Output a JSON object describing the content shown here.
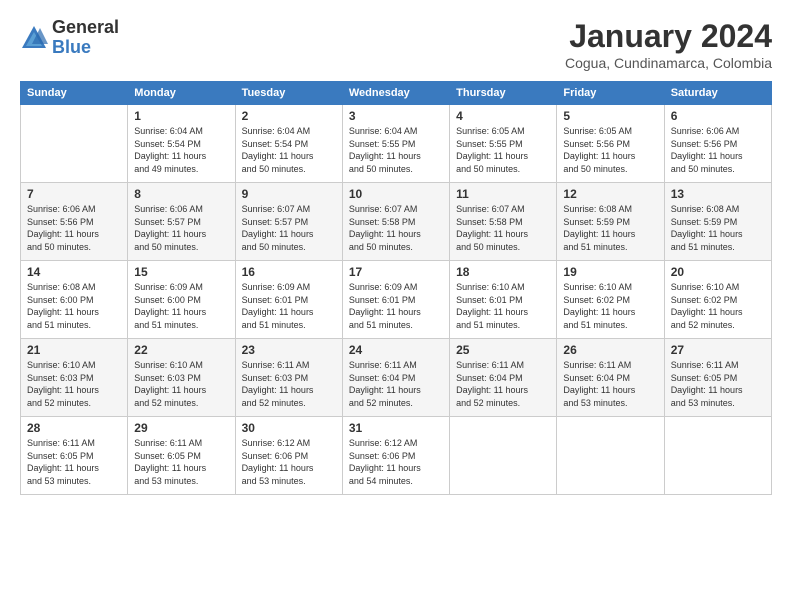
{
  "logo": {
    "general": "General",
    "blue": "Blue"
  },
  "title": "January 2024",
  "location": "Cogua, Cundinamarca, Colombia",
  "weekdays": [
    "Sunday",
    "Monday",
    "Tuesday",
    "Wednesday",
    "Thursday",
    "Friday",
    "Saturday"
  ],
  "weeks": [
    [
      {
        "day": "",
        "info": ""
      },
      {
        "day": "1",
        "info": "Sunrise: 6:04 AM\nSunset: 5:54 PM\nDaylight: 11 hours\nand 49 minutes."
      },
      {
        "day": "2",
        "info": "Sunrise: 6:04 AM\nSunset: 5:54 PM\nDaylight: 11 hours\nand 50 minutes."
      },
      {
        "day": "3",
        "info": "Sunrise: 6:04 AM\nSunset: 5:55 PM\nDaylight: 11 hours\nand 50 minutes."
      },
      {
        "day": "4",
        "info": "Sunrise: 6:05 AM\nSunset: 5:55 PM\nDaylight: 11 hours\nand 50 minutes."
      },
      {
        "day": "5",
        "info": "Sunrise: 6:05 AM\nSunset: 5:56 PM\nDaylight: 11 hours\nand 50 minutes."
      },
      {
        "day": "6",
        "info": "Sunrise: 6:06 AM\nSunset: 5:56 PM\nDaylight: 11 hours\nand 50 minutes."
      }
    ],
    [
      {
        "day": "7",
        "info": "Sunrise: 6:06 AM\nSunset: 5:56 PM\nDaylight: 11 hours\nand 50 minutes."
      },
      {
        "day": "8",
        "info": "Sunrise: 6:06 AM\nSunset: 5:57 PM\nDaylight: 11 hours\nand 50 minutes."
      },
      {
        "day": "9",
        "info": "Sunrise: 6:07 AM\nSunset: 5:57 PM\nDaylight: 11 hours\nand 50 minutes."
      },
      {
        "day": "10",
        "info": "Sunrise: 6:07 AM\nSunset: 5:58 PM\nDaylight: 11 hours\nand 50 minutes."
      },
      {
        "day": "11",
        "info": "Sunrise: 6:07 AM\nSunset: 5:58 PM\nDaylight: 11 hours\nand 50 minutes."
      },
      {
        "day": "12",
        "info": "Sunrise: 6:08 AM\nSunset: 5:59 PM\nDaylight: 11 hours\nand 51 minutes."
      },
      {
        "day": "13",
        "info": "Sunrise: 6:08 AM\nSunset: 5:59 PM\nDaylight: 11 hours\nand 51 minutes."
      }
    ],
    [
      {
        "day": "14",
        "info": "Sunrise: 6:08 AM\nSunset: 6:00 PM\nDaylight: 11 hours\nand 51 minutes."
      },
      {
        "day": "15",
        "info": "Sunrise: 6:09 AM\nSunset: 6:00 PM\nDaylight: 11 hours\nand 51 minutes."
      },
      {
        "day": "16",
        "info": "Sunrise: 6:09 AM\nSunset: 6:01 PM\nDaylight: 11 hours\nand 51 minutes."
      },
      {
        "day": "17",
        "info": "Sunrise: 6:09 AM\nSunset: 6:01 PM\nDaylight: 11 hours\nand 51 minutes."
      },
      {
        "day": "18",
        "info": "Sunrise: 6:10 AM\nSunset: 6:01 PM\nDaylight: 11 hours\nand 51 minutes."
      },
      {
        "day": "19",
        "info": "Sunrise: 6:10 AM\nSunset: 6:02 PM\nDaylight: 11 hours\nand 51 minutes."
      },
      {
        "day": "20",
        "info": "Sunrise: 6:10 AM\nSunset: 6:02 PM\nDaylight: 11 hours\nand 52 minutes."
      }
    ],
    [
      {
        "day": "21",
        "info": "Sunrise: 6:10 AM\nSunset: 6:03 PM\nDaylight: 11 hours\nand 52 minutes."
      },
      {
        "day": "22",
        "info": "Sunrise: 6:10 AM\nSunset: 6:03 PM\nDaylight: 11 hours\nand 52 minutes."
      },
      {
        "day": "23",
        "info": "Sunrise: 6:11 AM\nSunset: 6:03 PM\nDaylight: 11 hours\nand 52 minutes."
      },
      {
        "day": "24",
        "info": "Sunrise: 6:11 AM\nSunset: 6:04 PM\nDaylight: 11 hours\nand 52 minutes."
      },
      {
        "day": "25",
        "info": "Sunrise: 6:11 AM\nSunset: 6:04 PM\nDaylight: 11 hours\nand 52 minutes."
      },
      {
        "day": "26",
        "info": "Sunrise: 6:11 AM\nSunset: 6:04 PM\nDaylight: 11 hours\nand 53 minutes."
      },
      {
        "day": "27",
        "info": "Sunrise: 6:11 AM\nSunset: 6:05 PM\nDaylight: 11 hours\nand 53 minutes."
      }
    ],
    [
      {
        "day": "28",
        "info": "Sunrise: 6:11 AM\nSunset: 6:05 PM\nDaylight: 11 hours\nand 53 minutes."
      },
      {
        "day": "29",
        "info": "Sunrise: 6:11 AM\nSunset: 6:05 PM\nDaylight: 11 hours\nand 53 minutes."
      },
      {
        "day": "30",
        "info": "Sunrise: 6:12 AM\nSunset: 6:06 PM\nDaylight: 11 hours\nand 53 minutes."
      },
      {
        "day": "31",
        "info": "Sunrise: 6:12 AM\nSunset: 6:06 PM\nDaylight: 11 hours\nand 54 minutes."
      },
      {
        "day": "",
        "info": ""
      },
      {
        "day": "",
        "info": ""
      },
      {
        "day": "",
        "info": ""
      }
    ]
  ]
}
